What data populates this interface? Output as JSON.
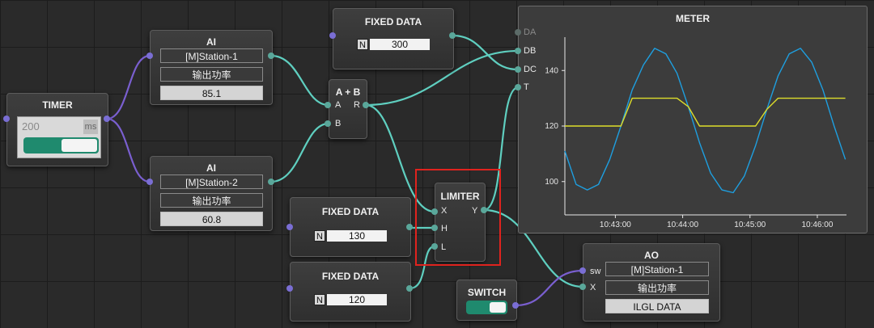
{
  "timer": {
    "title": "TIMER",
    "interval_value": "200",
    "interval_unit": "ms",
    "toggle_on": true
  },
  "ai1": {
    "title": "AI",
    "station": "[M]Station-1",
    "param": "输出功率",
    "value": "85.1"
  },
  "ai2": {
    "title": "AI",
    "station": "[M]Station-2",
    "param": "输出功率",
    "value": "60.8"
  },
  "fixed_top": {
    "title": "FIXED DATA",
    "badge": "N",
    "value": "300"
  },
  "fixed_h": {
    "title": "FIXED DATA",
    "badge": "N",
    "value": "130"
  },
  "fixed_l": {
    "title": "FIXED DATA",
    "badge": "N",
    "value": "120"
  },
  "adder": {
    "title": "A + B",
    "in_a": "A",
    "in_b": "B",
    "out_r": "R"
  },
  "limiter": {
    "title": "LIMITER",
    "in_x": "X",
    "in_h": "H",
    "in_l": "L",
    "out_y": "Y"
  },
  "switch_node": {
    "title": "SWITCH",
    "toggle_on": true
  },
  "ao": {
    "title": "AO",
    "station": "[M]Station-1",
    "param": "输出功率",
    "status": "ILGL DATA",
    "in_sw": "sw",
    "in_x": "X"
  },
  "meter": {
    "title": "METER",
    "inputs": [
      "DA",
      "DB",
      "DC",
      "T"
    ]
  },
  "colors": {
    "wire_teal": "#5fcfc0",
    "wire_purple": "#7a5fd0",
    "series_blue": "#1e9fe0",
    "series_yellow": "#dede2a",
    "highlight_red": "#e0231e"
  },
  "chart_data": {
    "type": "line",
    "title": "METER",
    "xlabel": "",
    "ylabel": "",
    "x_ticks": [
      "10:43:00",
      "10:44:00",
      "10:45:00",
      "10:46:00"
    ],
    "y_ticks": [
      100,
      120,
      140
    ],
    "ylim": [
      88,
      152
    ],
    "x_range_seconds": [
      0,
      251
    ],
    "grid": false,
    "series": [
      {
        "color": "#1e9fe0",
        "x": [
          0,
          10,
          20,
          30,
          40,
          50,
          60,
          70,
          80,
          90,
          100,
          110,
          120,
          130,
          140,
          150,
          160,
          170,
          180,
          190,
          200,
          210,
          220,
          230,
          240,
          250
        ],
        "y": [
          111,
          99,
          97,
          99,
          108,
          120,
          133,
          142,
          148,
          146,
          139,
          127,
          114,
          103,
          97,
          96,
          102,
          113,
          126,
          138,
          146,
          148,
          143,
          133,
          120,
          108
        ]
      },
      {
        "color": "#dede2a",
        "x": [
          0,
          10,
          20,
          30,
          40,
          50,
          60,
          70,
          80,
          90,
          100,
          110,
          120,
          130,
          140,
          150,
          160,
          170,
          180,
          190,
          200,
          210,
          220,
          230,
          240,
          250
        ],
        "y": [
          120,
          120,
          120,
          120,
          120,
          120,
          130,
          130,
          130,
          130,
          130,
          127,
          120,
          120,
          120,
          120,
          120,
          120,
          126,
          130,
          130,
          130,
          130,
          130,
          130,
          130
        ]
      }
    ]
  }
}
